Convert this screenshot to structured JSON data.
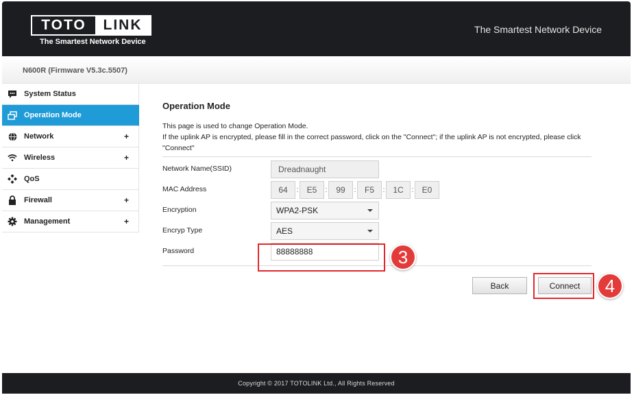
{
  "header": {
    "logo_left": "TOTO",
    "logo_right": "LINK",
    "logo_tagline": "The Smartest Network Device",
    "slogan": "The Smartest Network Device"
  },
  "subheader": {
    "model": "N600R (Firmware V5.3c.5507)"
  },
  "sidebar": {
    "items": [
      {
        "label": "System Status",
        "icon": "chat-icon",
        "expandable": false,
        "active": false
      },
      {
        "label": "Operation Mode",
        "icon": "operation-mode-icon",
        "expandable": false,
        "active": true
      },
      {
        "label": "Network",
        "icon": "globe-icon",
        "expandable": true,
        "active": false
      },
      {
        "label": "Wireless",
        "icon": "wifi-icon",
        "expandable": true,
        "active": false
      },
      {
        "label": "QoS",
        "icon": "qos-icon",
        "expandable": false,
        "active": false
      },
      {
        "label": "Firewall",
        "icon": "lock-icon",
        "expandable": true,
        "active": false
      },
      {
        "label": "Management",
        "icon": "gear-icon",
        "expandable": true,
        "active": false
      }
    ],
    "plus": "+"
  },
  "main": {
    "title": "Operation Mode",
    "description_line1": "This page is used to change Operation Mode.",
    "description_line2": "If the uplink AP is encrypted, please fill in the correct password, click on the \"Connect\"; if the uplink AP is not encrypted, please click \"Connect\"",
    "form": {
      "ssid_label": "Network Name(SSID)",
      "ssid_value": "Dreadnaught",
      "mac_label": "MAC Address",
      "mac_octets": [
        "64",
        "E5",
        "99",
        "F5",
        "1C",
        "E0"
      ],
      "mac_separator": ":",
      "encryption_label": "Encryption",
      "encryption_value": "WPA2-PSK",
      "encryp_type_label": "Encryp Type",
      "encryp_type_value": "AES",
      "password_label": "Password",
      "password_value": "88888888"
    },
    "buttons": {
      "back": "Back",
      "connect": "Connect"
    },
    "annotations": {
      "step_password": "3",
      "step_connect": "4",
      "highlight_color": "#e3262b"
    }
  },
  "footer": {
    "copyright": "Copyright © 2017 TOTOLINK Ltd.,   All Rights Reserved"
  },
  "colors": {
    "header_bg": "#1b1d20",
    "accent": "#1f9bd7",
    "annotation": "#e23b39"
  }
}
